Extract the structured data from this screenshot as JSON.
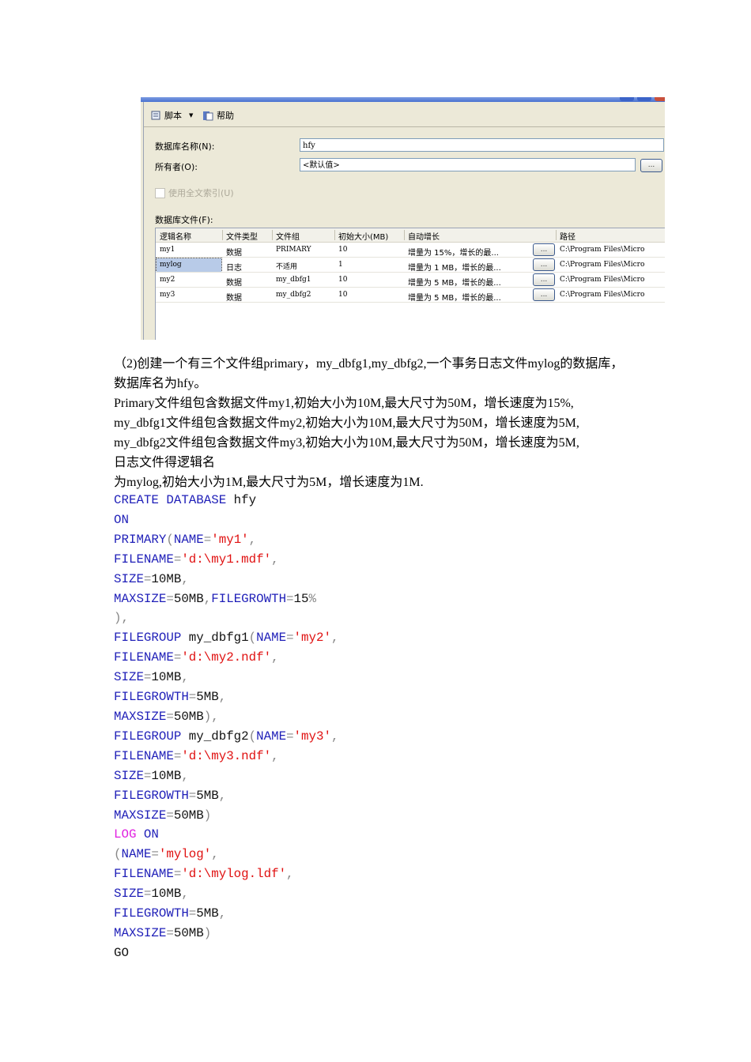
{
  "dialog": {
    "toolbar": {
      "script_label": "脚本",
      "help_label": "帮助"
    },
    "db_name_label": "数据库名称(N):",
    "db_name_value": "hfy",
    "owner_label": "所有者(O):",
    "owner_value": "<默认值>",
    "browse_label": "...",
    "fulltext_label": "使用全文索引(U)",
    "files_label": "数据库文件(F):",
    "columns": [
      "逻辑名称",
      "文件类型",
      "文件组",
      "初始大小(MB)",
      "自动增长",
      "路径"
    ],
    "rows": [
      {
        "name": "my1",
        "type": "数据",
        "group": "PRIMARY",
        "size": "10",
        "growth": "增量为 15%，增长的最...",
        "path": "C:\\Program Files\\Micro"
      },
      {
        "name": "mylog",
        "type": "日志",
        "group": "不适用",
        "size": "1",
        "growth": "增量为 1 MB，增长的最...",
        "path": "C:\\Program Files\\Micro"
      },
      {
        "name": "my2",
        "type": "数据",
        "group": "my_dbfg1",
        "size": "10",
        "growth": "增量为 5 MB，增长的最...",
        "path": "C:\\Program Files\\Micro"
      },
      {
        "name": "my3",
        "type": "数据",
        "group": "my_dbfg2",
        "size": "10",
        "growth": "增量为 5 MB，增长的最...",
        "path": "C:\\Program Files\\Micro"
      }
    ]
  },
  "prose": [
    "（2)创建一个有三个文件组primary，my_dbfg1,my_dbfg2,一个事务日志文件mylog的数据库，",
    "数据库名为hfy。",
    "Primary文件组包含数据文件my1,初始大小为10M,最大尺寸为50M，增长速度为15%,",
    "my_dbfg1文件组包含数据文件my2,初始大小为10M,最大尺寸为50M，增长速度为5M,",
    "my_dbfg2文件组包含数据文件my3,初始大小为10M,最大尺寸为50M，增长速度为5M,",
    "日志文件得逻辑名",
    "为mylog,初始大小为1M,最大尺寸为5M，增长速度为1M."
  ],
  "code": [
    [
      [
        "CREATE DATABASE",
        "k"
      ],
      [
        " hfy",
        "t"
      ]
    ],
    [
      [
        "ON",
        "k"
      ]
    ],
    [
      [
        "PRIMARY",
        "k"
      ],
      [
        "(",
        "p"
      ],
      [
        "NAME",
        "k"
      ],
      [
        "=",
        "p"
      ],
      [
        "'my1'",
        "s"
      ],
      [
        ",",
        "p"
      ]
    ],
    [
      [
        "FILENAME",
        "k"
      ],
      [
        "=",
        "p"
      ],
      [
        "'d:\\my1.mdf'",
        "s"
      ],
      [
        ",",
        "p"
      ]
    ],
    [
      [
        "SIZE",
        "k"
      ],
      [
        "=",
        "p"
      ],
      [
        "10MB",
        "t"
      ],
      [
        ",",
        "p"
      ]
    ],
    [
      [
        "MAXSIZE",
        "k"
      ],
      [
        "=",
        "p"
      ],
      [
        "50MB",
        "t"
      ],
      [
        ",",
        "p"
      ],
      [
        "FILEGROWTH",
        "k"
      ],
      [
        "=",
        "p"
      ],
      [
        "15",
        "t"
      ],
      [
        "%",
        "p"
      ]
    ],
    [
      [
        "),",
        "p"
      ]
    ],
    [
      [
        "FILEGROUP",
        "k"
      ],
      [
        " my_dbfg1",
        "t"
      ],
      [
        "(",
        "p"
      ],
      [
        "NAME",
        "k"
      ],
      [
        "=",
        "p"
      ],
      [
        "'my2'",
        "s"
      ],
      [
        ",",
        "p"
      ]
    ],
    [
      [
        "FILENAME",
        "k"
      ],
      [
        "=",
        "p"
      ],
      [
        "'d:\\my2.ndf'",
        "s"
      ],
      [
        ",",
        "p"
      ]
    ],
    [
      [
        "SIZE",
        "k"
      ],
      [
        "=",
        "p"
      ],
      [
        "10MB",
        "t"
      ],
      [
        ",",
        "p"
      ]
    ],
    [
      [
        "FILEGROWTH",
        "k"
      ],
      [
        "=",
        "p"
      ],
      [
        "5MB",
        "t"
      ],
      [
        ",",
        "p"
      ]
    ],
    [
      [
        "MAXSIZE",
        "k"
      ],
      [
        "=",
        "p"
      ],
      [
        "50MB",
        "t"
      ],
      [
        "),",
        "p"
      ]
    ],
    [
      [
        "FILEGROUP",
        "k"
      ],
      [
        " my_dbfg2",
        "t"
      ],
      [
        "(",
        "p"
      ],
      [
        "NAME",
        "k"
      ],
      [
        "=",
        "p"
      ],
      [
        "'my3'",
        "s"
      ],
      [
        ",",
        "p"
      ]
    ],
    [
      [
        "FILENAME",
        "k"
      ],
      [
        "=",
        "p"
      ],
      [
        "'d:\\my3.ndf'",
        "s"
      ],
      [
        ",",
        "p"
      ]
    ],
    [
      [
        "SIZE",
        "k"
      ],
      [
        "=",
        "p"
      ],
      [
        "10MB",
        "t"
      ],
      [
        ",",
        "p"
      ]
    ],
    [
      [
        "FILEGROWTH",
        "k"
      ],
      [
        "=",
        "p"
      ],
      [
        "5MB",
        "t"
      ],
      [
        ",",
        "p"
      ]
    ],
    [
      [
        "MAXSIZE",
        "k"
      ],
      [
        "=",
        "p"
      ],
      [
        "50MB",
        "t"
      ],
      [
        ")",
        "p"
      ]
    ],
    [
      [
        "LOG",
        "m"
      ],
      [
        " ON",
        "k"
      ]
    ],
    [
      [
        "(",
        "p"
      ],
      [
        "NAME",
        "k"
      ],
      [
        "=",
        "p"
      ],
      [
        "'mylog'",
        "s"
      ],
      [
        ",",
        "p"
      ]
    ],
    [
      [
        "FILENAME",
        "k"
      ],
      [
        "=",
        "p"
      ],
      [
        "'d:\\mylog.ldf'",
        "s"
      ],
      [
        ",",
        "p"
      ]
    ],
    [
      [
        "SIZE",
        "k"
      ],
      [
        "=",
        "p"
      ],
      [
        "10MB",
        "t"
      ],
      [
        ",",
        "p"
      ]
    ],
    [
      [
        "FILEGROWTH",
        "k"
      ],
      [
        "=",
        "p"
      ],
      [
        "5MB",
        "t"
      ],
      [
        ",",
        "p"
      ]
    ],
    [
      [
        "MAXSIZE",
        "k"
      ],
      [
        "=",
        "p"
      ],
      [
        "50MB",
        "t"
      ],
      [
        ")",
        "p"
      ]
    ],
    [
      [
        "GO",
        "t"
      ]
    ]
  ]
}
